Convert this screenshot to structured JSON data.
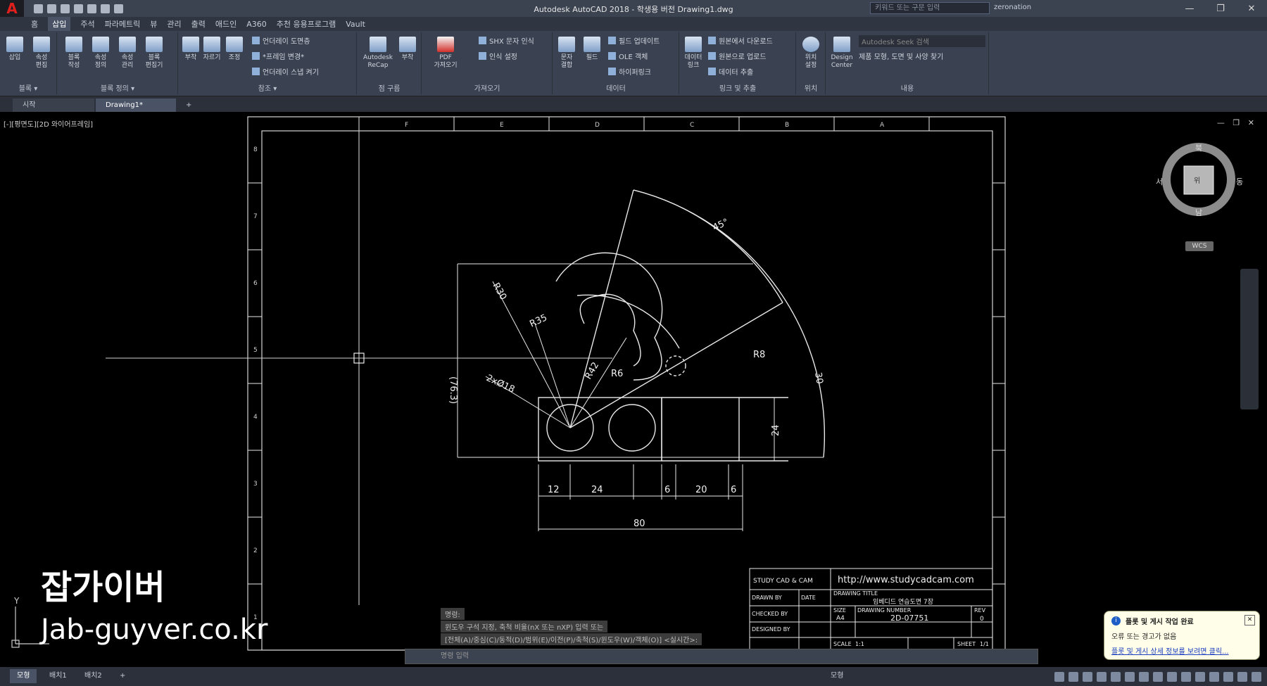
{
  "window": {
    "title": "Autodesk AutoCAD 2018 - 학생용 버전    Drawing1.dwg",
    "search_placeholder": "키워드 또는 구문 입력",
    "user": "zeronation",
    "minimize": "—",
    "restore": "❐",
    "close": "✕"
  },
  "menu": [
    "홈",
    "삽입",
    "주석",
    "파라메트릭",
    "뷰",
    "관리",
    "출력",
    "애드인",
    "A360",
    "추천 응용프로그램",
    "Vault"
  ],
  "ribbon": {
    "groups": [
      {
        "label": "블록 ▾",
        "buttons": [
          "삽입",
          "속성\n편집"
        ]
      },
      {
        "label": "블록 정의 ▾",
        "buttons": [
          "블록\n작성",
          "속성\n정의",
          "속성\n관리",
          "블록\n편집기"
        ]
      },
      {
        "label": "참조 ▾",
        "buttons": [
          "부착",
          "자르기",
          "조정"
        ],
        "small": [
          "언더레이 도면층",
          "*프레임 변경*",
          "언더레이 스냅 켜기"
        ]
      },
      {
        "label": "점 구름",
        "buttons": [
          "Autodesk\nReCap",
          "부착"
        ]
      },
      {
        "label": "가져오기",
        "buttons": [
          "PDF\n가져오기"
        ],
        "small": [
          "SHX 문자 인식",
          "인식 설정"
        ]
      },
      {
        "label": "데이터",
        "buttons": [
          "문자\n결합",
          "필드"
        ],
        "small": [
          "필드 업데이트",
          "OLE 객체",
          "하이퍼링크"
        ]
      },
      {
        "label": "링크 및 추출",
        "buttons": [
          "데이터\n링크"
        ],
        "small": [
          "원본에서 다운로드",
          "원본으로 업로드",
          "데이터 추출"
        ]
      },
      {
        "label": "위치",
        "buttons": [
          "위치\n설정"
        ]
      },
      {
        "label": "내용",
        "buttons": [
          "Design\nCenter"
        ],
        "small": [
          "Autodesk Seek 검색",
          "제품 모형, 도면 및 사양 찾기"
        ]
      }
    ]
  },
  "doc_tabs": [
    "시작",
    "Drawing1*",
    "+"
  ],
  "viewport_label": "[-][평면도][2D 와이어프레임]",
  "viewport_controls": "— ❐ ✕",
  "navcube": {
    "top": "북",
    "bottom": "남",
    "left": "서",
    "right": "동",
    "face": "위",
    "wcs": "WCS"
  },
  "drawing": {
    "dim_texts": [
      "45°",
      "R30",
      "R35",
      "R42",
      "R6",
      "R8",
      "2xØ18",
      "(76.3)",
      "30",
      "24",
      "12",
      "24",
      "6",
      "20",
      "6",
      "80"
    ],
    "border_letters": [
      "F",
      "E",
      "D",
      "C",
      "B",
      "A"
    ],
    "border_numbers_left": [
      "8",
      "7",
      "6",
      "5",
      "4",
      "3",
      "2",
      "1"
    ],
    "title_block": {
      "url": "http://www.studycadcam.com",
      "company": "STUDY CAD & CAM",
      "drawn_by": "DRAWN BY",
      "checked_by": "CHECKED BY",
      "designed_by": "DESIGNED BY",
      "date": "DATE",
      "drawing_title_label": "DRAWING TITLE",
      "drawing_title": "임베디드 연습도면 7장",
      "size_label": "SIZE",
      "size": "A4",
      "drawing_number_label": "DRAWING NUMBER",
      "drawing_number": "2D-07751",
      "rev_label": "REV",
      "rev": "0",
      "scale_label": "SCALE",
      "scale": "1:1",
      "sheet_label": "SHEET",
      "sheet": "1/1"
    }
  },
  "command_history": [
    "명령: ",
    "윈도우 구석 지정, 축척 비율(nX 또는 nXP) 입력 또는",
    "[전체(A)/중심(C)/동적(D)/범위(E)/이전(P)/축척(S)/윈도우(W)/객체(O)] <실시간>:"
  ],
  "command_prompt": "명령 입력",
  "layout_tabs": [
    "모형",
    "배치1",
    "배치2",
    "+"
  ],
  "status_mode": "모형",
  "notification": {
    "title": "플롯 및 게시 작업 완료",
    "body": "오류 또는 경고가 없음",
    "link": "플롯 및 게시 상세 정보를 보려면 클릭..."
  },
  "watermark": {
    "line1": "잡가이버",
    "line2": "Jab-guyver.co.kr"
  },
  "colors": {
    "background": "#000000",
    "titlebar": "#3b4250",
    "ribbon": "#3a4150",
    "lines": "#ffffff",
    "accent": "#e0201c"
  }
}
